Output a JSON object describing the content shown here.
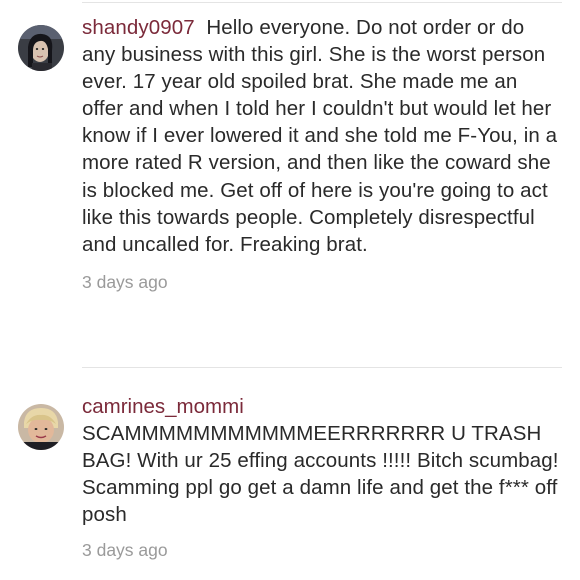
{
  "comments": [
    {
      "username": "shandy0907",
      "text": "Hello everyone. Do not order or do any business with this girl. She is the worst person ever. 17 year old spoiled brat. She made me an offer and when I told her I couldn't but would let her know if I ever lowered it and she told me F-You, in a more rated R version, and then like the coward she is blocked me. Get off of here is you're going to act like this towards people. Completely disrespectful and uncalled for. Freaking brat.",
      "timestamp": "3 days ago",
      "avatar_icon": "user-avatar"
    },
    {
      "username": "camrines_mommi",
      "text": "SCAMMMMMMMMMMMEERRRRRRR U TRASH BAG! With ur 25 effing accounts !!!!! Bitch scumbag! Scamming ppl go get a damn life and get the f*** off posh",
      "timestamp": "3 days ago",
      "avatar_icon": "user-avatar"
    }
  ],
  "colors": {
    "username": "#7b2a3a",
    "text": "#2a2a2a",
    "timestamp": "#9a9a9a",
    "divider": "#e4e4e4"
  }
}
